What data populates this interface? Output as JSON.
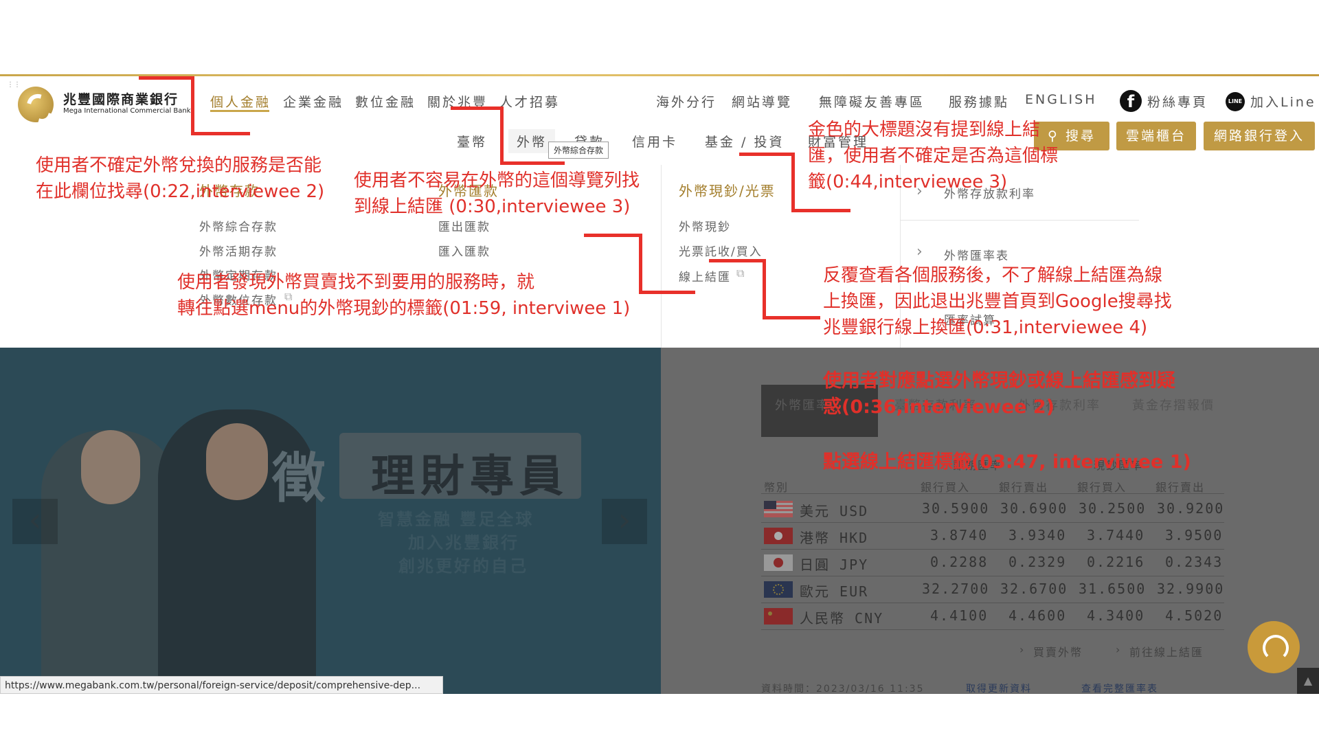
{
  "header": {
    "logo_cn": "兆豐國際商業銀行",
    "logo_en": "Mega International Commercial Bank",
    "primary_nav": [
      "個人金融",
      "企業金融",
      "數位金融",
      "關於兆豐",
      "人才招募"
    ],
    "utility_nav": [
      "海外分行",
      "網站導覽",
      "無障礙友善專區",
      "服務據點",
      "ENGLISH"
    ],
    "social": {
      "facebook": "粉絲專頁",
      "line": "加入Line",
      "line_icon_text": "LINE"
    },
    "secondary_nav": [
      "臺幣",
      "外幣",
      "貸款",
      "信用卡",
      "基金 / 投資",
      "財富管理"
    ],
    "tooltip": "外幣綜合存款",
    "buttons": {
      "search": "搜尋",
      "cloud": "雲端櫃台",
      "login": "網路銀行登入"
    }
  },
  "mega_menu": {
    "col1": {
      "title": "外幣存款",
      "items": [
        "外幣綜合存款",
        "外幣活期存款",
        "外幣定期存款",
        "外幣數位存款"
      ]
    },
    "col2": {
      "title": "外幣匯款",
      "items": [
        "匯出匯款",
        "匯入匯款"
      ]
    },
    "col3": {
      "title": "外幣現鈔/光票",
      "items": [
        "外幣現鈔",
        "光票託收/買入",
        "線上結匯"
      ]
    },
    "right": [
      "外幣存放款利率",
      "外幣匯率表",
      "匯率試算"
    ]
  },
  "banner": {
    "zheng": "徵",
    "title": "理財專員",
    "sub1": "智慧金融 豐足全球",
    "sub2": "加入兆豐銀行",
    "sub3": "創兆更好的自己",
    "prev": "‹",
    "next": "›"
  },
  "rates": {
    "tabs": [
      "外幣匯率",
      "臺幣存款利率",
      "外幣存款利率",
      "黃金存摺報價"
    ],
    "group_headers": [
      "即期匯率",
      "現鈔匯率"
    ],
    "columns": [
      "幣別",
      "銀行買入",
      "銀行賣出",
      "銀行買入",
      "銀行賣出"
    ],
    "rows": [
      {
        "currency": "美元 USD",
        "flag": "us-flag-icon",
        "values": [
          "30.5900",
          "30.6900",
          "30.2500",
          "30.9200"
        ]
      },
      {
        "currency": "港幣 HKD",
        "flag": "hk-flag-icon",
        "values": [
          "3.8740",
          "3.9340",
          "3.7440",
          "3.9500"
        ]
      },
      {
        "currency": "日圓 JPY",
        "flag": "jp-flag-icon",
        "values": [
          "0.2288",
          "0.2329",
          "0.2216",
          "0.2343"
        ]
      },
      {
        "currency": "歐元 EUR",
        "flag": "eu-flag-icon",
        "values": [
          "32.2700",
          "32.6700",
          "31.6500",
          "32.9900"
        ]
      },
      {
        "currency": "人民幣 CNY",
        "flag": "cn-flag-icon",
        "values": [
          "4.4100",
          "4.4600",
          "4.3400",
          "4.5020"
        ]
      }
    ],
    "links": [
      "買賣外幣",
      "前往線上結匯"
    ],
    "footer": "資料時間：2023/03/16 11:35",
    "refresh": "取得更新資料",
    "full": "查看完整匯率表"
  },
  "status_url": "https://www.megabank.com.tw/personal/foreign-service/deposit/comprehensive-dep...",
  "annotations": {
    "a1": [
      "使用者不確定外幣兌換的服務是否能",
      "在此欄位找尋(0:22,interviewee 2)"
    ],
    "a2": [
      "使用者不容易在外幣的這個導覽列找",
      "到線上結匯 (0:30,interviewee 3)"
    ],
    "a3": [
      "金色的大標題沒有提到線上結",
      "匯，使用者不確定是否為這個標",
      "籤(0:44,interviewee 3)"
    ],
    "a4": [
      "使用者發現外幣買賣找不到要用的服務時，就",
      "轉往點選menu的外幣現鈔的標籤(01:59, interviwee 1)"
    ],
    "a5": [
      "反覆查看各個服務後，不了解線上結匯為線",
      "上換匯，因此退出兆豐首頁到Google搜尋找",
      "兆豐銀行線上換匯(0:31,interviewee 4)"
    ],
    "a6": [
      "使用者對應點選外幣現鈔或線上結匯感到疑",
      "惑(0:36,interviewee 2)"
    ],
    "a7": "點選線上結匯標籤(03:47, interviwee 1)"
  },
  "colors": {
    "gold": "#c09a44",
    "annotation_red": "#e0302a"
  }
}
